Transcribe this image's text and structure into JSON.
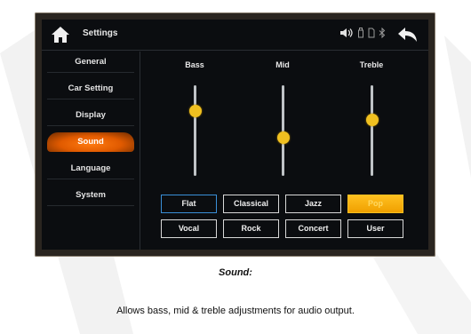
{
  "header": {
    "title": "Settings"
  },
  "status_icons": [
    "speaker-icon",
    "usb-icon",
    "sd-card-icon",
    "bluetooth-icon"
  ],
  "sidebar": {
    "items": [
      {
        "label": "General"
      },
      {
        "label": "Car Setting"
      },
      {
        "label": "Display"
      },
      {
        "label": "Sound",
        "active": true
      },
      {
        "label": "Language"
      },
      {
        "label": "System"
      }
    ]
  },
  "equalizer": {
    "bands": [
      {
        "label": "Bass",
        "level": 0.28
      },
      {
        "label": "Mid",
        "level": 0.58
      },
      {
        "label": "Treble",
        "level": 0.38
      }
    ]
  },
  "presets": {
    "row1": [
      {
        "label": "Flat",
        "state": "focused"
      },
      {
        "label": "Classical"
      },
      {
        "label": "Jazz"
      },
      {
        "label": "Pop",
        "state": "active"
      }
    ],
    "row2": [
      {
        "label": "Vocal"
      },
      {
        "label": "Rock"
      },
      {
        "label": "Concert"
      },
      {
        "label": "User"
      }
    ]
  },
  "captions": {
    "heading": "Sound:",
    "description": "Allows bass, mid & treble adjustments for audio output."
  },
  "colors": {
    "accent": "#f0c020",
    "active_tab": "#ff7a10",
    "focus": "#3a8fd8"
  }
}
